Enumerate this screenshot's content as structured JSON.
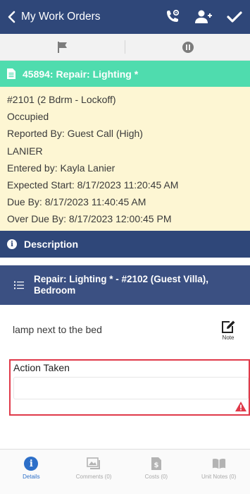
{
  "topbar": {
    "back_label": "My Work Orders",
    "actions": [
      "phone-settings-icon",
      "add-user-icon",
      "checkmark-icon"
    ]
  },
  "subbar": {
    "left_icon": "flag-icon",
    "right_icon": "pause-icon"
  },
  "work_order": {
    "header": "45894: Repair: Lighting *",
    "lines": [
      "#2101 (2 Bdrm - Lockoff)",
      "Occupied",
      "Reported By: Guest Call  (High)",
      "LANIER",
      "Entered by: Kayla Lanier",
      "Expected Start: 8/17/2023 11:20:45 AM",
      "Due By: 8/17/2023 11:40:45 AM",
      "Over Due By: 8/17/2023 12:00:45 PM"
    ]
  },
  "description": {
    "title": "Description"
  },
  "task": {
    "title": "Repair: Lighting * - #2102 (Guest Villa), Bedroom"
  },
  "detail": {
    "text": "lamp next to the bed",
    "note_label": "Note"
  },
  "action_taken": {
    "label": "Action Taken",
    "value": ""
  },
  "bottom_tabs": [
    {
      "label": "Details",
      "icon": "info-icon",
      "active": true
    },
    {
      "label": "Comments (0)",
      "icon": "image-icon",
      "active": false
    },
    {
      "label": "Costs (0)",
      "icon": "invoice-icon",
      "active": false
    },
    {
      "label": "Unit Notes (0)",
      "icon": "book-icon",
      "active": false
    }
  ],
  "colors": {
    "nav": "#2f4779",
    "header_green": "#4fdcae",
    "info_bg": "#fdf6d3",
    "error": "#e03a4a",
    "active_tab": "#2d6fc8"
  }
}
